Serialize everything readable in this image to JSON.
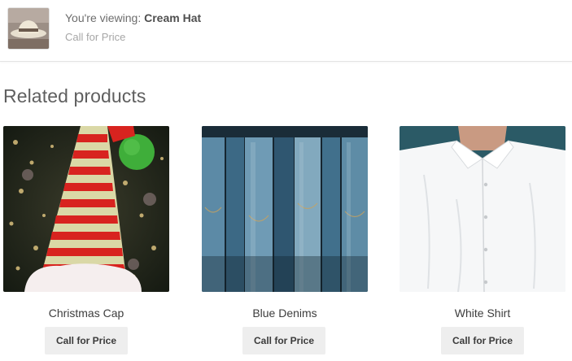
{
  "viewing": {
    "prefix": "You're viewing:",
    "product_name": "Cream Hat",
    "price_text": "Call for Price"
  },
  "related": {
    "title": "Related products",
    "products": [
      {
        "name": "Christmas Cap",
        "button_label": "Call for Price",
        "image": "christmas-cap-photo"
      },
      {
        "name": "Blue Denims",
        "button_label": "Call for Price",
        "image": "blue-denims-photo"
      },
      {
        "name": "White Shirt",
        "button_label": "Call for Price",
        "image": "white-shirt-photo"
      }
    ]
  },
  "colors": {
    "cap_red": "#d8231f",
    "cap_stripe": "#d9d7a8",
    "pompom_green": "#3fae3a",
    "denim": "#3b6f8f",
    "shirt": "#f4f5f6"
  }
}
